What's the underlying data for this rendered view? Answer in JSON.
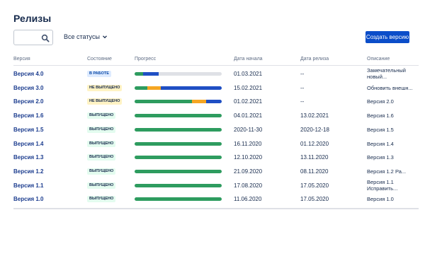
{
  "page": {
    "title": "Релизы"
  },
  "toolbar": {
    "search": {
      "value": "",
      "placeholder": ""
    },
    "status_filter": {
      "label": "Все статусы"
    },
    "create_label": "Создать версию"
  },
  "table": {
    "headers": {
      "version": "Версия",
      "state": "Состояние",
      "progress": "Прогресс",
      "start": "Дата начала",
      "release": "Дата релиза",
      "description": "Описание"
    },
    "rows": [
      {
        "version": "Версия 4.0",
        "state": "В РАБОТЕ",
        "state_type": "work",
        "progress": {
          "done": 0.1,
          "in_progress": 0,
          "todo": 0.18
        },
        "start": "01.03.2021",
        "release": "--",
        "description": "Замечательный новый..."
      },
      {
        "version": "Версия 3.0",
        "state": "НЕ ВЫПУЩЕНО",
        "state_type": "unreleased",
        "progress": {
          "done": 0.15,
          "in_progress": 0.15,
          "todo": 0.7
        },
        "start": "15.02.2021",
        "release": "--",
        "description": "Обновить внешн..."
      },
      {
        "version": "Версия 2.0",
        "state": "НЕ ВЫПУЩЕНО",
        "state_type": "unreleased",
        "progress": {
          "done": 0.66,
          "in_progress": 0.16,
          "todo": 0.18
        },
        "start": "01.02.2021",
        "release": "--",
        "description": "Версия 2.0"
      },
      {
        "version": "Версия 1.6",
        "state": "ВЫПУЩЕНО",
        "state_type": "released",
        "progress": {
          "done": 1,
          "in_progress": 0,
          "todo": 0
        },
        "start": "04.01.2021",
        "release": "13.02.2021",
        "description": "Версия 1.6"
      },
      {
        "version": "Версия 1.5",
        "state": "ВЫПУЩЕНО",
        "state_type": "released",
        "progress": {
          "done": 1,
          "in_progress": 0,
          "todo": 0
        },
        "start": "2020-11-30",
        "release": "2020-12-18",
        "description": "Версия 1.5"
      },
      {
        "version": "Версия 1.4",
        "state": "ВЫПУЩЕНО",
        "state_type": "released",
        "progress": {
          "done": 1,
          "in_progress": 0,
          "todo": 0
        },
        "start": "16.11.2020",
        "release": "01.12.2020",
        "description": "Версия 1.4"
      },
      {
        "version": "Версия 1.3",
        "state": "ВЫПУЩЕНО",
        "state_type": "released",
        "progress": {
          "done": 1,
          "in_progress": 0,
          "todo": 0
        },
        "start": "12.10.2020",
        "release": "13.11.2020",
        "description": "Версия 1.3"
      },
      {
        "version": "Версия 1.2",
        "state": "ВЫПУЩЕНО",
        "state_type": "released",
        "progress": {
          "done": 1,
          "in_progress": 0,
          "todo": 0
        },
        "start": "21.09.2020",
        "release": "08.11.2020",
        "description": "Версия 1.2 Ра..."
      },
      {
        "version": "Версия 1.1",
        "state": "ВЫПУЩЕНО",
        "state_type": "released",
        "progress": {
          "done": 1,
          "in_progress": 0,
          "todo": 0
        },
        "start": "17.08.2020",
        "release": "17.05.2020",
        "description": "Версия 1.1 Исправить..."
      },
      {
        "version": "Версия 1.0",
        "state": "ВЫПУЩЕНО",
        "state_type": "released",
        "progress": {
          "done": 1,
          "in_progress": 0,
          "todo": 0
        },
        "start": "11.06.2020",
        "release": "17.05.2020",
        "description": "Версия 1.0"
      }
    ]
  },
  "icons": {
    "search": "search-icon",
    "dropdown": "chevron-down-icon"
  },
  "colors": {
    "accent": "#0b4dc9",
    "version_link": "#1c3d8f",
    "progress_done": "#2e9c5f",
    "progress_in_progress": "#f5a623",
    "progress_todo": "#1f4fc4",
    "progress_empty": "#dfe1e6"
  }
}
